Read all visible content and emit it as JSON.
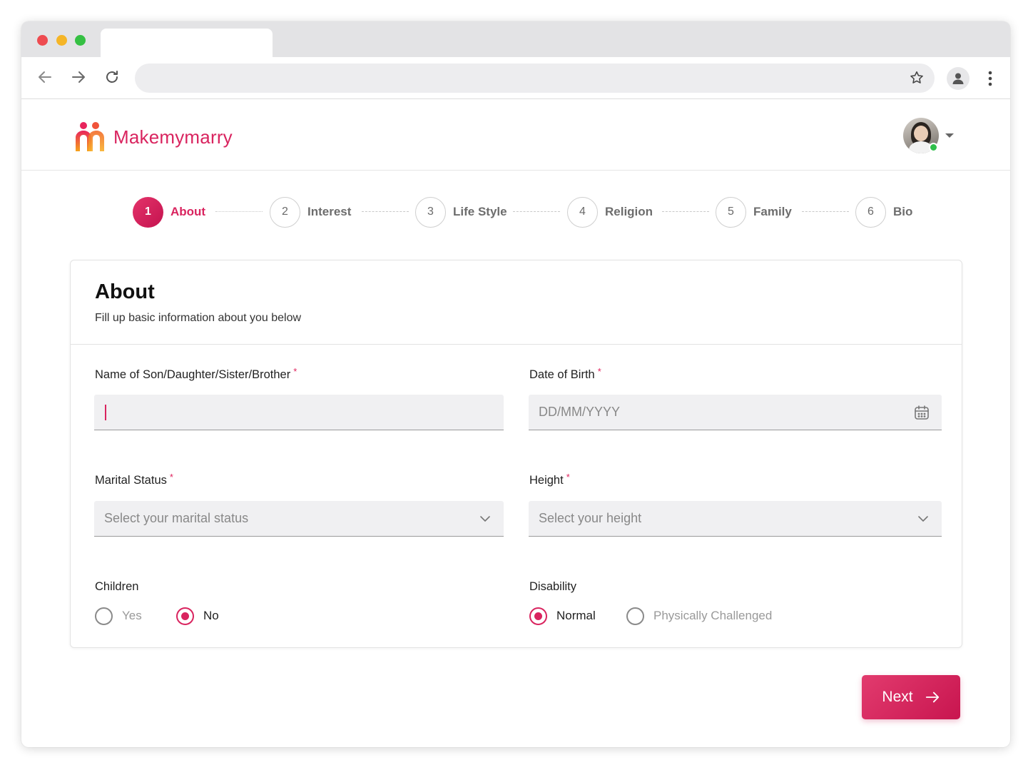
{
  "app": {
    "name": "Makemymarry",
    "brand_color": "#d9245f"
  },
  "steps": [
    {
      "number": "1",
      "label": "About",
      "active": true
    },
    {
      "number": "2",
      "label": "Interest",
      "active": false
    },
    {
      "number": "3",
      "label": "Life Style",
      "active": false
    },
    {
      "number": "4",
      "label": "Religion",
      "active": false
    },
    {
      "number": "5",
      "label": "Family",
      "active": false
    },
    {
      "number": "6",
      "label": "Bio",
      "active": false
    }
  ],
  "form": {
    "title": "About",
    "subtitle": "Fill up basic information about you below",
    "name_label": "Name of Son/Daughter/Sister/Brother",
    "name_value": "",
    "dob_label": "Date of Birth",
    "dob_placeholder": "DD/MM/YYYY",
    "marital_label": "Marital Status",
    "marital_placeholder": "Select your marital status",
    "height_label": "Height",
    "height_placeholder": "Select your height",
    "required_mark": "*",
    "children": {
      "label": "Children",
      "options": [
        "Yes",
        "No"
      ],
      "selected": "No"
    },
    "disability": {
      "label": "Disability",
      "options": [
        "Normal",
        "Physically Challenged"
      ],
      "selected": "Normal"
    }
  },
  "actions": {
    "next_label": "Next"
  },
  "icons": {
    "back": "arrow-left-icon",
    "forward": "arrow-right-icon",
    "reload": "reload-icon",
    "bookmark": "star-icon",
    "profile": "person-icon",
    "menu": "kebab-icon",
    "calendar": "calendar-icon",
    "dropdown": "chevron-down-icon"
  }
}
